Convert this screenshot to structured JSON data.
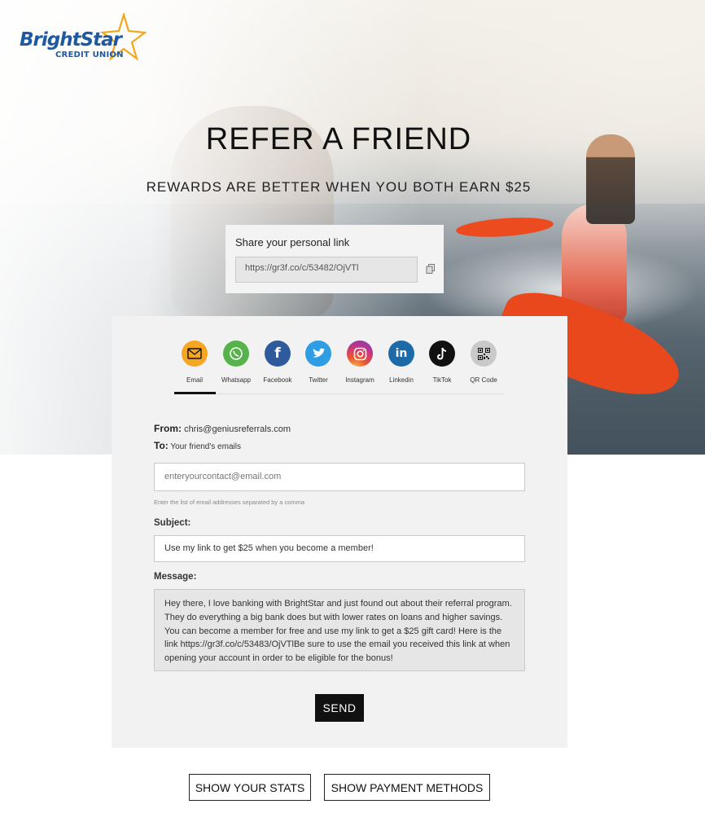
{
  "brand": {
    "name": "BrightStar",
    "subtitle": "CREDIT UNION",
    "colors": {
      "primary": "#1f5aa0",
      "star": "#f2a81d"
    }
  },
  "hero": {
    "title": "REFER A FRIEND",
    "subtitle": "REWARDS ARE BETTER WHEN YOU BOTH EARN $25"
  },
  "personal_link": {
    "label": "Share your personal link",
    "url": "https://gr3f.co/c/53482/OjVTl",
    "copy_icon": "copy-icon"
  },
  "share_channels": [
    {
      "label": "Email",
      "icon": "envelope-icon",
      "color": "#f5a623",
      "active": true
    },
    {
      "label": "Whatsapp",
      "icon": "whatsapp-icon",
      "color": "#56b24a"
    },
    {
      "label": "Facebook",
      "icon": "facebook-icon",
      "color": "#2f5a9c"
    },
    {
      "label": "Twitter",
      "icon": "twitter-icon",
      "color": "#2f9de4"
    },
    {
      "label": "Instagram",
      "icon": "instagram-icon",
      "color": "#c8367f"
    },
    {
      "label": "Linkedin",
      "icon": "linkedin-icon",
      "color": "#1d6aa8"
    },
    {
      "label": "TikTok",
      "icon": "tiktok-icon",
      "color": "#111111"
    },
    {
      "label": "QR Code",
      "icon": "qr-code-icon",
      "color": "#c9c9c9"
    }
  ],
  "email_form": {
    "from_label": "From:",
    "from_value": "chris@geniusreferrals.com",
    "to_label": "To:",
    "to_value": "Your friend's emails",
    "contacts_placeholder": "enteryourcontact@email.com",
    "contacts_hint": "Enter the list of email addresses separated by a comma",
    "subject_label": "Subject:",
    "subject_value": "Use my link to get $25 when you become a member!",
    "message_label": "Message:",
    "message_value": "Hey there, I love banking with BrightStar and just found out about their referral program. They do everything a big bank does but with lower rates on loans and higher savings. You can become a member for free and use my link to get a $25 gift card! Here is the link https://gr3f.co/c/53483/OjVTlBe sure to use the email you received this link at when opening your account in order to be eligible for the bonus!",
    "send_label": "SEND"
  },
  "footer": {
    "stats_label": "SHOW YOUR STATS",
    "payment_label": "SHOW PAYMENT METHODS"
  }
}
